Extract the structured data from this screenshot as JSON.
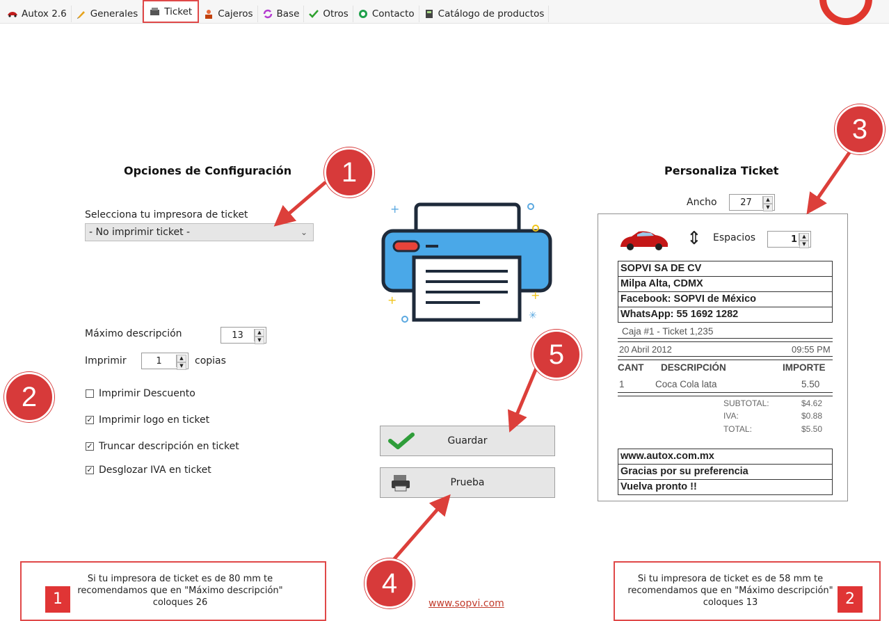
{
  "tabs": [
    {
      "label": "Autox 2.6",
      "icon": "car-icon"
    },
    {
      "label": "Generales",
      "icon": "pencil-icon"
    },
    {
      "label": "Ticket",
      "icon": "cash-icon"
    },
    {
      "label": "Cajeros",
      "icon": "cashier-icon"
    },
    {
      "label": "Base",
      "icon": "sync-icon"
    },
    {
      "label": "Otros",
      "icon": "check-icon"
    },
    {
      "label": "Contacto",
      "icon": "whatsapp-icon"
    },
    {
      "label": "Catálogo de productos",
      "icon": "calculator-icon"
    }
  ],
  "left": {
    "title": "Opciones de Configuración",
    "printer_label": "Selecciona tu impresora de ticket",
    "printer_value": "- No imprimir ticket -",
    "max_desc_label": "Máximo descripción",
    "max_desc_value": "13",
    "print_label": "Imprimir",
    "copies_value": "1",
    "copies_suffix": "copias",
    "checkboxes": [
      {
        "label": "Imprimir Descuento",
        "checked": false
      },
      {
        "label": "Imprimir logo en ticket",
        "checked": true
      },
      {
        "label": "Truncar descripción en ticket",
        "checked": true
      },
      {
        "label": "Desglozar IVA en ticket",
        "checked": true
      }
    ]
  },
  "buttons": {
    "save_label": "Guardar",
    "test_label": "Prueba"
  },
  "right": {
    "title": "Personaliza Ticket",
    "width_label": "Ancho",
    "width_value": "27",
    "spaces_label": "Espacios",
    "spaces_value": "1"
  },
  "ticket": {
    "header_lines": [
      "SOPVI SA DE CV",
      "Milpa Alta, CDMX",
      "Facebook: SOPVI de México",
      "WhatsApp: 55 1692 1282"
    ],
    "caja": "Caja #1 - Ticket 1,235",
    "date": "20 Abril 2012",
    "time": "09:55 PM",
    "col_qty": "CANT",
    "col_desc": "DESCRIPCIÓN",
    "col_amount": "IMPORTE",
    "item_qty": "1",
    "item_desc": "Coca Cola lata",
    "item_amount": "5.50",
    "subtotal_label": "SUBTOTAL:",
    "subtotal_value": "$4.62",
    "iva_label": "IVA:",
    "iva_value": "$0.88",
    "total_label": "TOTAL:",
    "total_value": "$5.50",
    "footer_lines": [
      "www.autox.com.mx",
      "Gracias por su preferencia",
      "Vuelva pronto !!"
    ]
  },
  "info_left": {
    "text": "Si tu impresora de ticket es de 80 mm te recomendamos que en \"Máximo descripción\" coloques 26",
    "number": "1"
  },
  "info_right": {
    "text": "Si tu impresora de ticket es de 58 mm te recomendamos que en \"Máximo descripción\" coloques 13",
    "number": "2"
  },
  "footer_link": "www.sopvi.com",
  "badges": [
    "1",
    "2",
    "3",
    "4",
    "5"
  ],
  "colors": {
    "accent_red": "#d73a3a",
    "printer_blue": "#4aa8e8",
    "box_border": "#e04848"
  }
}
